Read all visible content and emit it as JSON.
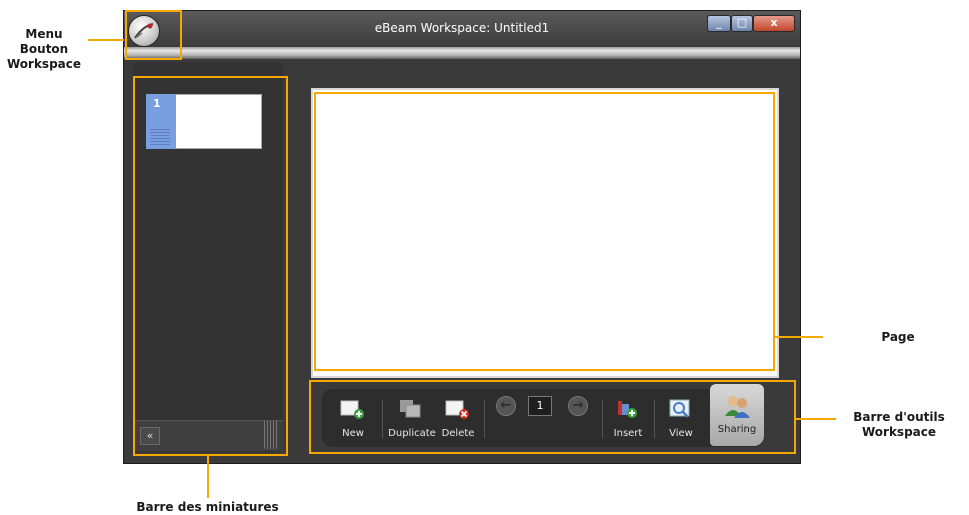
{
  "window": {
    "title": "eBeam Workspace: Untitled1",
    "controls": {
      "minimize": "_",
      "maximize": "□",
      "close": "x"
    }
  },
  "sidebar": {
    "thumbnail_number": "1",
    "collapse_label": "«"
  },
  "toolbar": {
    "new_label": "New",
    "duplicate_label": "Duplicate",
    "delete_label": "Delete",
    "prev_label": "←",
    "page_number": "1",
    "next_label": "→",
    "insert_label": "Insert",
    "view_label": "View",
    "sharing_label": "Sharing"
  },
  "annotations": {
    "menu_line1": "Menu",
    "menu_line2": "Bouton",
    "menu_line3": "Workspace",
    "page": "Page",
    "toolbar_line1": "Barre d'outils",
    "toolbar_line2": "Workspace",
    "thumbnails": "Barre des miniatures"
  },
  "colors": {
    "highlight": "#f5a800",
    "window_bg": "#3a3a3a",
    "thumbnail_accent": "#7a9fe0"
  },
  "icons": [
    "app-menu-icon",
    "new-page-icon",
    "duplicate-icon",
    "delete-page-icon",
    "arrow-left-icon",
    "arrow-right-icon",
    "insert-icon",
    "view-icon",
    "sharing-icon"
  ]
}
